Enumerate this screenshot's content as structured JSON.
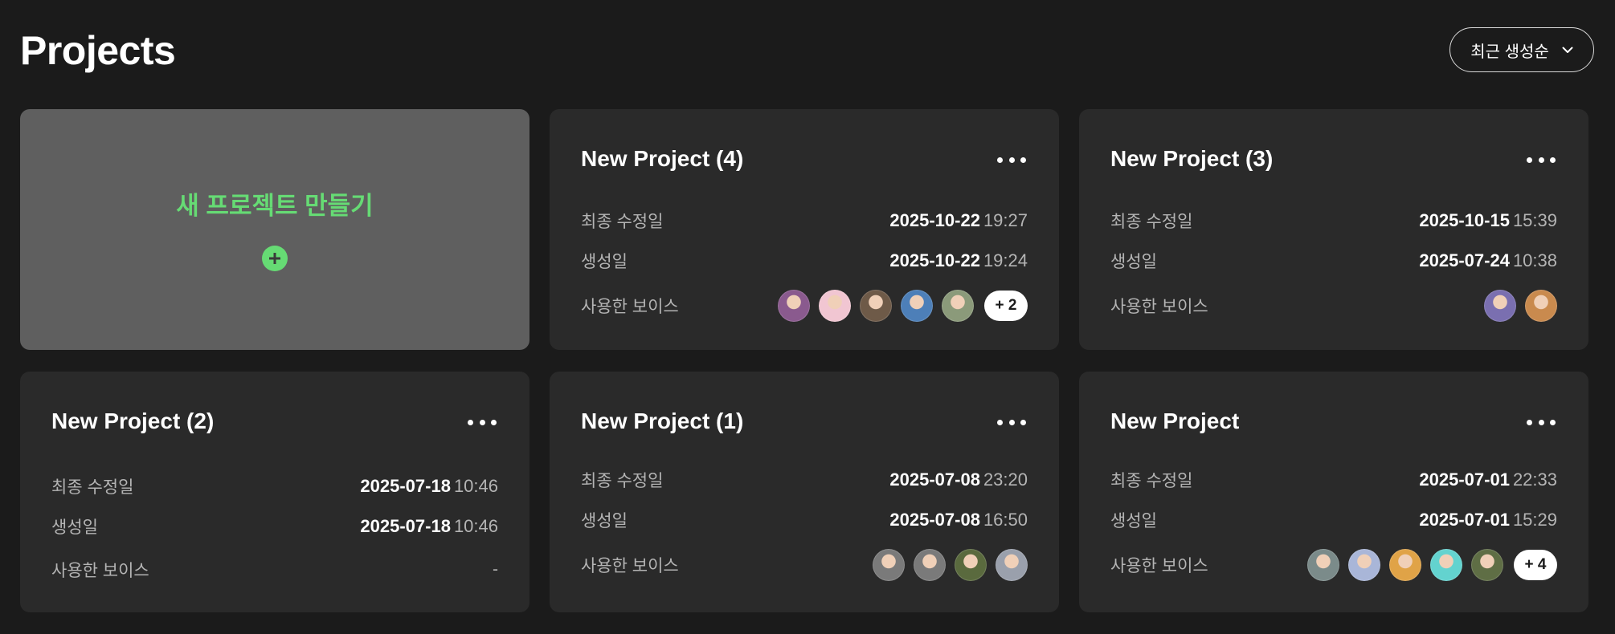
{
  "header": {
    "title": "Projects",
    "sort_label": "최근 생성순"
  },
  "labels": {
    "modified": "최종 수정일",
    "created": "생성일",
    "voices": "사용한 보이스"
  },
  "new_project": {
    "label": "새 프로젝트 만들기"
  },
  "projects": [
    {
      "title": "New Project (4)",
      "modified_date": "2025-10-22",
      "modified_time": "19:27",
      "created_date": "2025-10-22",
      "created_time": "19:24",
      "voices": [
        "#8a5a8e",
        "#f1c6d2",
        "#6e5a48",
        "#4d7fb8",
        "#8b9a7a"
      ],
      "more_badge": "+ 2",
      "voices_empty": ""
    },
    {
      "title": "New Project (3)",
      "modified_date": "2025-10-15",
      "modified_time": "15:39",
      "created_date": "2025-07-24",
      "created_time": "10:38",
      "voices": [
        "#7a6fb0",
        "#c98a4e"
      ],
      "more_badge": "",
      "voices_empty": ""
    },
    {
      "title": "New Project (2)",
      "modified_date": "2025-07-18",
      "modified_time": "10:46",
      "created_date": "2025-07-18",
      "created_time": "10:46",
      "voices": [],
      "more_badge": "",
      "voices_empty": "-"
    },
    {
      "title": "New Project (1)",
      "modified_date": "2025-07-08",
      "modified_time": "23:20",
      "created_date": "2025-07-08",
      "created_time": "16:50",
      "voices": [
        "#7a7a7a",
        "#7a7a7a",
        "#5a6a3e",
        "#9aa0ac"
      ],
      "more_badge": "",
      "voices_empty": ""
    },
    {
      "title": "New Project",
      "modified_date": "2025-07-01",
      "modified_time": "22:33",
      "created_date": "2025-07-01",
      "created_time": "15:29",
      "voices": [
        "#7b8b8a",
        "#a9b6d8",
        "#e0a347",
        "#63d3cf",
        "#5f6e45"
      ],
      "more_badge": "+ 4",
      "voices_empty": ""
    }
  ]
}
